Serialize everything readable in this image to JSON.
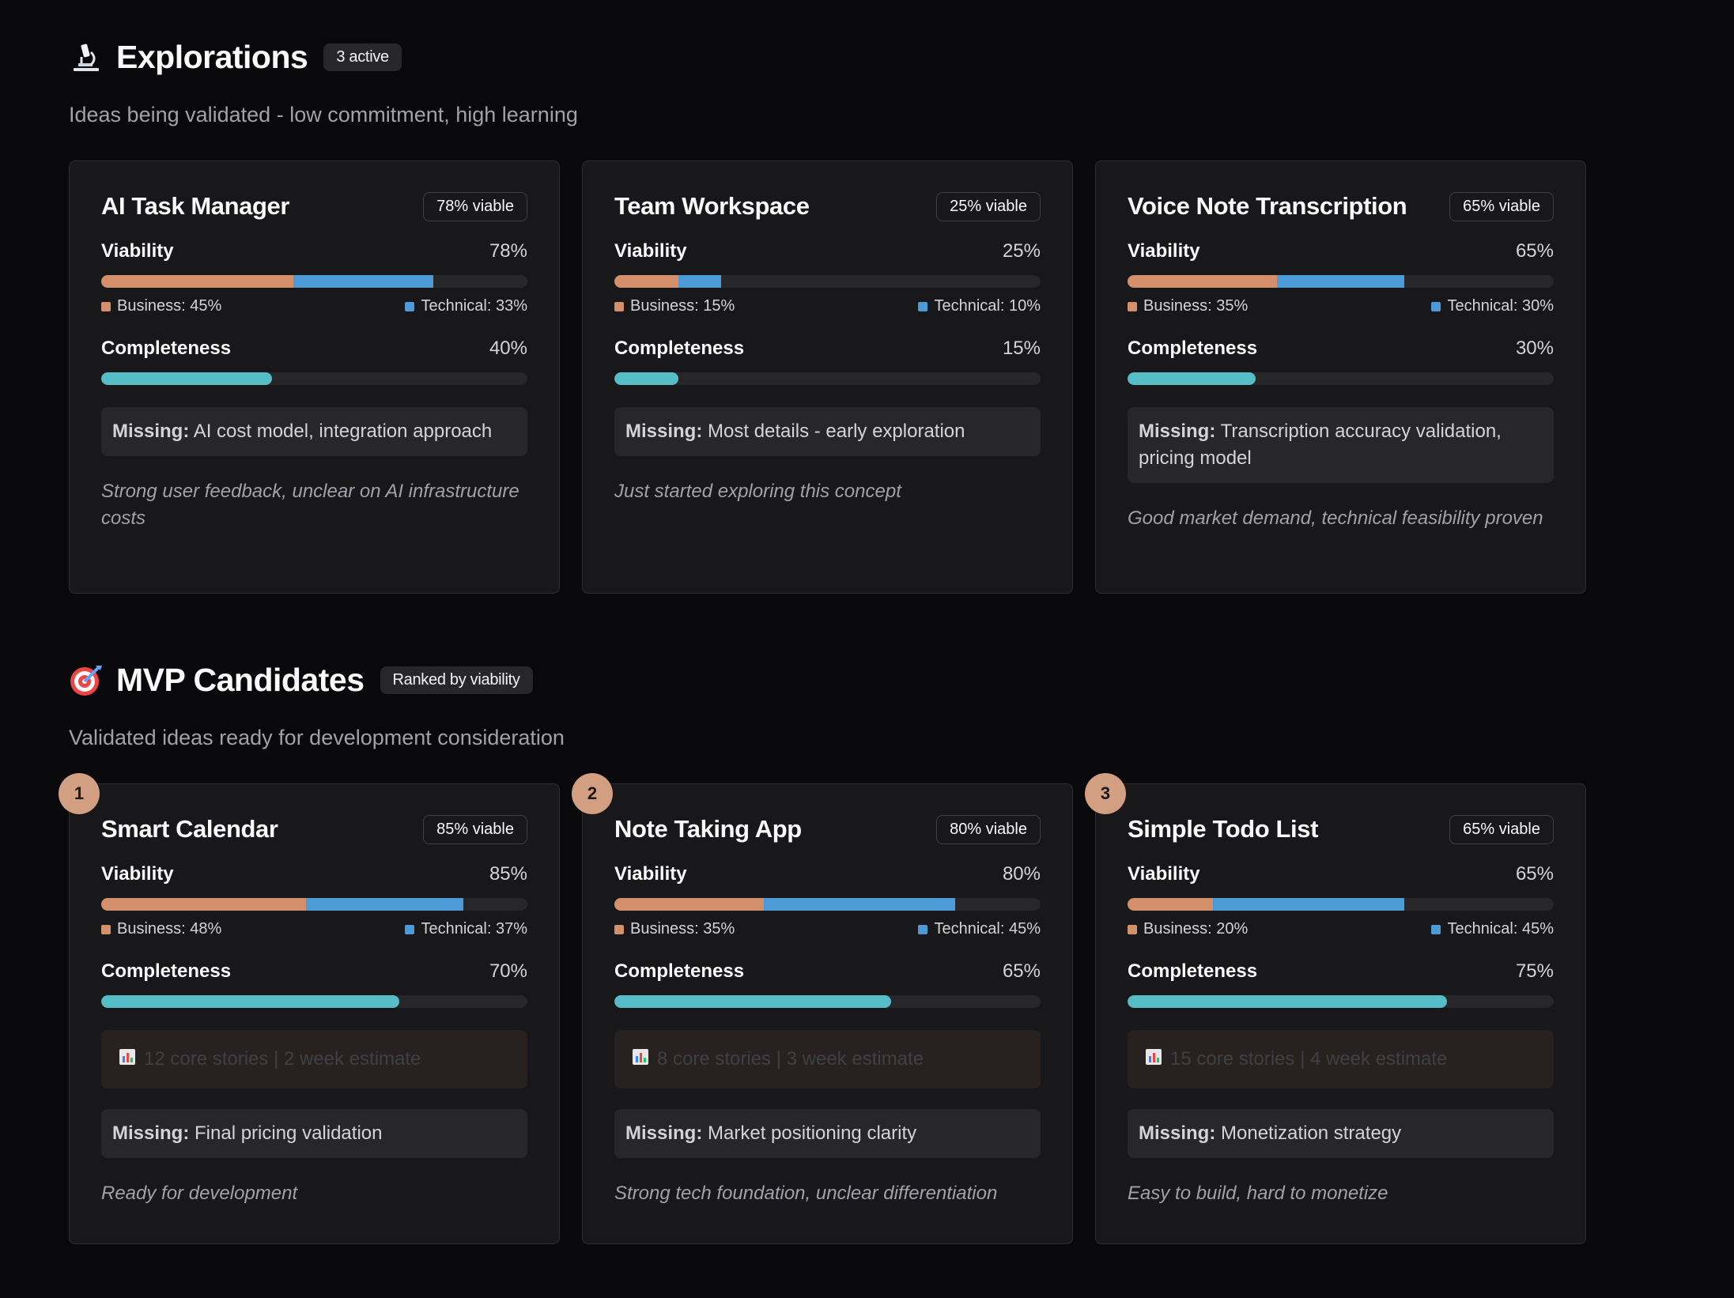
{
  "explorations": {
    "title": "Explorations",
    "badge": "3 active",
    "subtitle": "Ideas being validated - low commitment, high learning",
    "icon": "microscope-icon",
    "cards": [
      {
        "title": "AI Task Manager",
        "badge": "78% viable",
        "viability_label": "Viability",
        "viability": "78%",
        "business": "Business: 45%",
        "technical": "Technical: 33%",
        "business_pct": 45,
        "technical_pct": 33,
        "completeness_label": "Completeness",
        "completeness": "40%",
        "completeness_pct": 40,
        "missing_label": "Missing:",
        "missing": "AI cost model, integration approach",
        "note": "Strong user feedback, unclear on AI infrastructure costs"
      },
      {
        "title": "Team Workspace",
        "badge": "25% viable",
        "viability_label": "Viability",
        "viability": "25%",
        "business": "Business: 15%",
        "technical": "Technical: 10%",
        "business_pct": 15,
        "technical_pct": 10,
        "completeness_label": "Completeness",
        "completeness": "15%",
        "completeness_pct": 15,
        "missing_label": "Missing:",
        "missing": "Most details - early exploration",
        "note": "Just started exploring this concept"
      },
      {
        "title": "Voice Note Transcription",
        "badge": "65% viable",
        "viability_label": "Viability",
        "viability": "65%",
        "business": "Business: 35%",
        "technical": "Technical: 30%",
        "business_pct": 35,
        "technical_pct": 30,
        "completeness_label": "Completeness",
        "completeness": "30%",
        "completeness_pct": 30,
        "missing_label": "Missing:",
        "missing": "Transcription accuracy validation, pricing model",
        "note": "Good market demand, technical feasibility proven"
      }
    ]
  },
  "mvp": {
    "title": "MVP Candidates",
    "badge": "Ranked by viability",
    "subtitle": "Validated ideas ready for development consideration",
    "icon": "target-icon",
    "cards": [
      {
        "rank": "1",
        "title": "Smart Calendar",
        "badge": "85% viable",
        "viability_label": "Viability",
        "viability": "85%",
        "business": "Business: 48%",
        "technical": "Technical: 37%",
        "business_pct": 48,
        "technical_pct": 37,
        "completeness_label": "Completeness",
        "completeness": "70%",
        "completeness_pct": 70,
        "stories": "12 core stories | 2 week estimate",
        "missing_label": "Missing:",
        "missing": "Final pricing validation",
        "note": "Ready for development"
      },
      {
        "rank": "2",
        "title": "Note Taking App",
        "badge": "80% viable",
        "viability_label": "Viability",
        "viability": "80%",
        "business": "Business: 35%",
        "technical": "Technical: 45%",
        "business_pct": 35,
        "technical_pct": 45,
        "completeness_label": "Completeness",
        "completeness": "65%",
        "completeness_pct": 65,
        "stories": "8 core stories | 3 week estimate",
        "missing_label": "Missing:",
        "missing": "Market positioning clarity",
        "note": "Strong tech foundation, unclear differentiation"
      },
      {
        "rank": "3",
        "title": "Simple Todo List",
        "badge": "65% viable",
        "viability_label": "Viability",
        "viability": "65%",
        "business": "Business: 20%",
        "technical": "Technical: 45%",
        "business_pct": 20,
        "technical_pct": 45,
        "completeness_label": "Completeness",
        "completeness": "75%",
        "completeness_pct": 75,
        "stories": "15 core stories | 4 week estimate",
        "missing_label": "Missing:",
        "missing": "Monetization strategy",
        "note": "Easy to build, hard to monetize"
      }
    ]
  },
  "colors": {
    "business": "#d4906b",
    "technical": "#4d9bd6",
    "completeness": "#56bdc7",
    "rank": "#d29f82"
  }
}
